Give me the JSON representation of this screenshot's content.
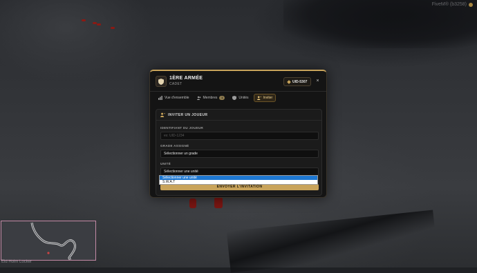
{
  "watermark": {
    "text": "FiveM® (b3258)"
  },
  "minimap": {
    "label": "Eld Holm Locker"
  },
  "modal": {
    "title": "1ÈRE ARMÉE",
    "subtitle": "CADET",
    "uid_badge": "UID-5307",
    "close_label": "×",
    "tabs": [
      {
        "label": "Vue d'ensemble",
        "icon": "grid-icon"
      },
      {
        "label": "Membres",
        "icon": "users-icon",
        "badge": "1"
      },
      {
        "label": "Unités",
        "icon": "units-icon"
      },
      {
        "label": "Inviter",
        "icon": "user-plus-icon",
        "active": true
      }
    ],
    "section": {
      "title": "INVITER UN JOUEUR",
      "player_id": {
        "label": "IDENTIFIANT DU JOUEUR",
        "placeholder": "ex: UID-1234",
        "value": ""
      },
      "grade": {
        "label": "GRADE ASSIGNÉ",
        "value": "Sélectionner un grade"
      },
      "unit": {
        "label": "UNITÉ",
        "value": "Sélectionner une unité",
        "options": [
          "Sélectionner une unité",
          "S.W.A.T"
        ]
      },
      "submit_label": "ENVOYER L'INVITATION"
    }
  },
  "colors": {
    "accent": "#c9a45b",
    "panel": "#141414",
    "select_highlight": "#1e78d2"
  }
}
